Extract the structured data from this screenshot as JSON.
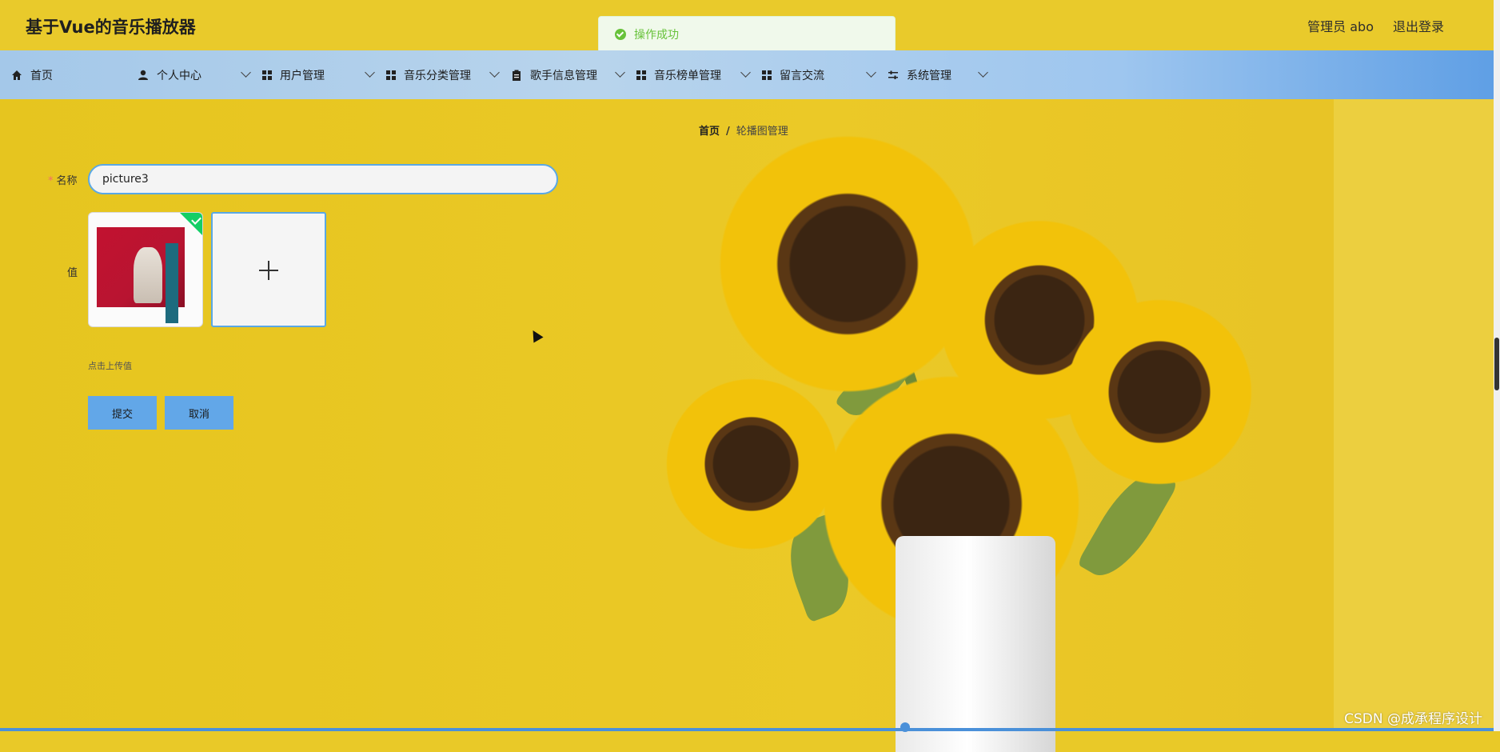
{
  "header": {
    "title": "基于Vue的音乐播放器",
    "user_label": "管理员 abo",
    "logout_label": "退出登录"
  },
  "toast": {
    "message": "操作成功",
    "icon": "success-check-icon",
    "color": "#67c23a"
  },
  "nav": {
    "items": [
      {
        "label": "首页",
        "icon": "home-icon"
      },
      {
        "label": "个人中心",
        "icon": "user-icon"
      },
      {
        "label": "用户管理",
        "icon": "grid-icon"
      },
      {
        "label": "音乐分类管理",
        "icon": "grid-icon"
      },
      {
        "label": "歌手信息管理",
        "icon": "clipboard-icon"
      },
      {
        "label": "音乐榜单管理",
        "icon": "grid-icon"
      },
      {
        "label": "留言交流",
        "icon": "grid-icon"
      },
      {
        "label": "系统管理",
        "icon": "sliders-icon"
      }
    ]
  },
  "breadcrumb": {
    "home": "首页",
    "separator": "/",
    "current": "轮播图管理"
  },
  "form": {
    "name_label": "名称",
    "name_value": "picture3",
    "value_label": "值",
    "upload_hint": "点击上传值",
    "submit_label": "提交",
    "cancel_label": "取消"
  },
  "watermark": "CSDN @成承程序设计",
  "colors": {
    "header_bg": "#e9ca2b",
    "nav_accent": "#5f9fe5",
    "button_bg": "#62a7e8",
    "input_border": "#5aa8e5"
  }
}
